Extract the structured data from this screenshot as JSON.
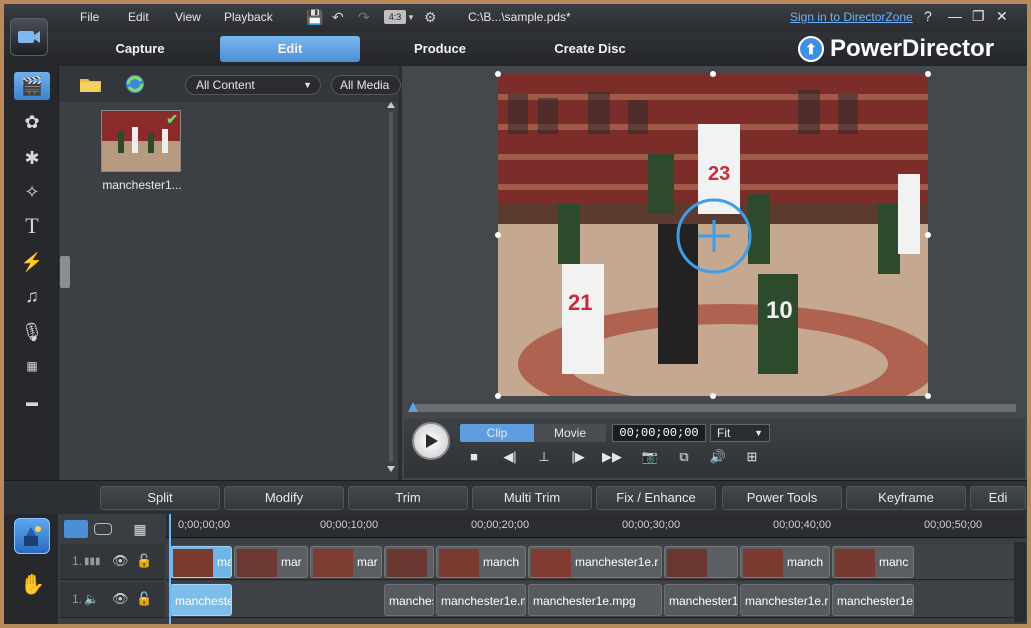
{
  "menu": {
    "file": "File",
    "edit": "Edit",
    "view": "View",
    "playback": "Playback",
    "aspect": "4:3",
    "filepath": "C:\\B...\\sample.pds*",
    "signin": "Sign in to DirectorZone",
    "help": "?"
  },
  "modes": {
    "capture": "Capture",
    "edit": "Edit",
    "produce": "Produce",
    "create_disc": "Create Disc"
  },
  "brand": {
    "name": "PowerDirector"
  },
  "library": {
    "content_filter": "All Content",
    "media_filter": "All Media",
    "item_name": "manchester1..."
  },
  "preview": {
    "clip_tab": "Clip",
    "movie_tab": "Movie",
    "timecode": "00;00;00;00",
    "zoom": "Fit"
  },
  "functions": {
    "split": "Split",
    "modify": "Modify",
    "trim": "Trim",
    "multi_trim": "Multi Trim",
    "fix_enhance": "Fix / Enhance",
    "power_tools": "Power Tools",
    "keyframe": "Keyframe",
    "edit_more": "Edi"
  },
  "timeline": {
    "ruler": [
      "0;00;00;00",
      "00;00;10;00",
      "00;00;20;00",
      "00;00;30;00",
      "00;00;40;00",
      "00;00;50;00"
    ],
    "video_track_num": "1.",
    "audio_track_num": "1.",
    "video_clips": [
      "ma",
      "mar",
      "mar",
      "",
      "manch",
      "manchester1e.r",
      "",
      "manch",
      "manc"
    ],
    "audio_clips": [
      "mancheste",
      "manches",
      "manchester1e.m",
      "manchester1e.mpg",
      "manchester1",
      "manchester1e.r",
      "manchester1e."
    ]
  },
  "colors": {
    "accent": "#4d8fd6",
    "link": "#6cb4ff",
    "frame": "#b98a5a"
  }
}
